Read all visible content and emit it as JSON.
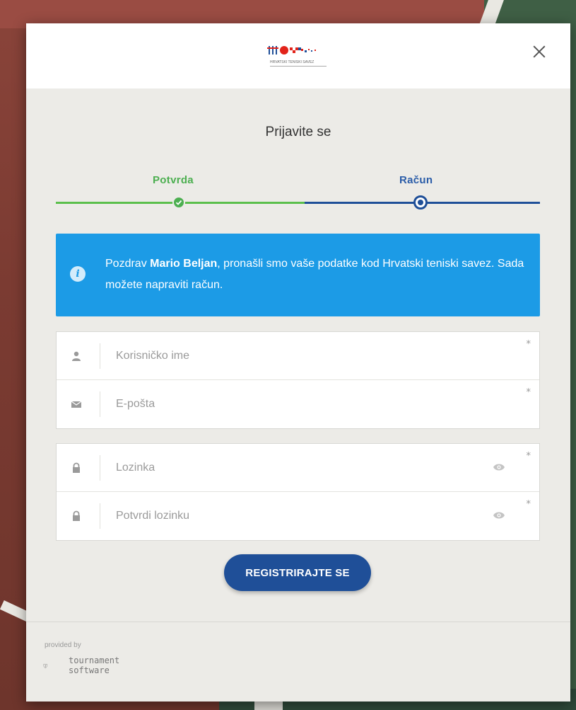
{
  "modal": {
    "logo_caption": "HRVATSKI TENISKI SAVEZ",
    "title": "Prijavite se"
  },
  "stepper": {
    "steps": [
      {
        "label": "Potvrda",
        "state": "done"
      },
      {
        "label": "Račun",
        "state": "active"
      }
    ]
  },
  "alert": {
    "prefix": "Pozdrav ",
    "name": "Mario Beljan",
    "suffix": ", pronašli smo vaše podatke kod Hrvatski teniski savez. Sada možete napraviti račun."
  },
  "form": {
    "username": {
      "placeholder": "Korisničko ime",
      "value": "",
      "required": "*"
    },
    "email": {
      "placeholder": "E-pošta",
      "value": "",
      "required": "*"
    },
    "password": {
      "placeholder": "Lozinka",
      "value": "",
      "required": "*"
    },
    "confirm_password": {
      "placeholder": "Potvrdi lozinku",
      "value": "",
      "required": "*"
    },
    "submit_label": "REGISTRIRAJTE SE"
  },
  "footer": {
    "provided_by": "provided by",
    "brand_line1": "tournament",
    "brand_line2": "software"
  },
  "colors": {
    "primary": "#1f4f98",
    "success": "#4caf50",
    "info": "#1c9be6"
  }
}
